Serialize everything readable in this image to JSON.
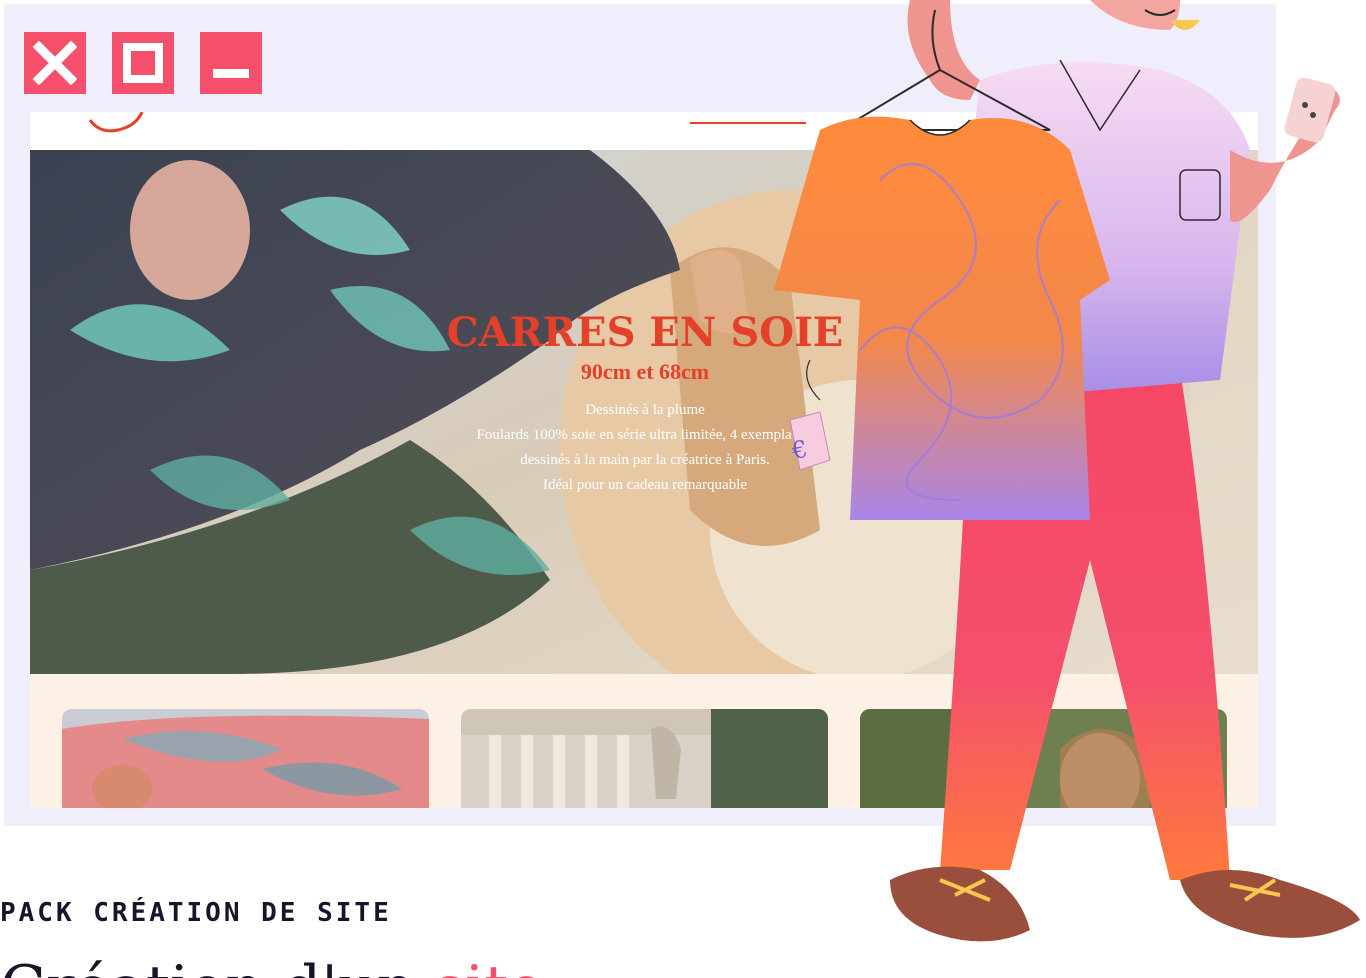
{
  "window_controls": {
    "close_icon": "close-icon",
    "maximize_icon": "maximize-icon",
    "minimize_icon": "minimize-icon",
    "color": "#f4506c"
  },
  "hero": {
    "title": "CARRES EN SOIE",
    "subtitle": "90cm et 68cm",
    "desc_line1": "Dessinés à la plume",
    "desc_line2": "Foulards 100% soie en série ultra limitée, 4 exemplaires",
    "desc_line3": "dessinés à la main par la créatrice à Paris.",
    "desc_line4": "Idéal pour un cadeau remarquable"
  },
  "price_tag": "€",
  "section": {
    "label": "PACK CRÉATION DE SITE",
    "title_start": "Création d'un ",
    "title_accent": "site"
  },
  "colors": {
    "accent": "#f4506c",
    "brand_red": "#e5402a",
    "frame": "#f1eefb"
  }
}
